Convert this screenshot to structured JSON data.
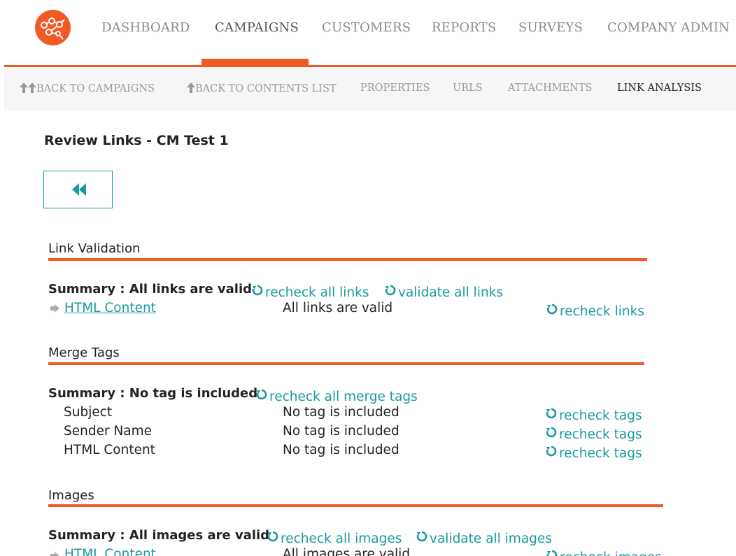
{
  "topnav": {
    "items": [
      {
        "label": "DASHBOARD"
      },
      {
        "label": "CAMPAIGNS",
        "active": true
      },
      {
        "label": "CUSTOMERS"
      },
      {
        "label": "REPORTS"
      },
      {
        "label": "SURVEYS"
      },
      {
        "label": "COMPANY ADMIN"
      }
    ]
  },
  "subnav": {
    "items": [
      {
        "label": "BACK TO CAMPAIGNS"
      },
      {
        "label": "BACK TO CONTENTS LIST"
      },
      {
        "label": "PROPERTIES"
      },
      {
        "label": "URLS"
      },
      {
        "label": "ATTACHMENTS"
      },
      {
        "label": "LINK ANALYSIS",
        "active": true
      }
    ]
  },
  "page": {
    "title": "Review Links - CM Test 1"
  },
  "colors": {
    "accent": "#f15a24",
    "link": "#1a9aa0"
  },
  "link_validation": {
    "title": "Link Validation",
    "summary": "Summary : All links are valid",
    "recheck_all": "recheck all links",
    "validate_all": "validate all links",
    "rows": [
      {
        "label": "HTML Content",
        "value": "All links are valid",
        "action": "recheck links"
      }
    ]
  },
  "merge_tags": {
    "title": "Merge Tags",
    "summary": "Summary : No tag is included",
    "recheck_all": "recheck all merge tags",
    "rows": [
      {
        "label": "Subject",
        "value": "No tag is included",
        "action": "recheck tags"
      },
      {
        "label": "Sender Name",
        "value": "No tag is included",
        "action": "recheck tags"
      },
      {
        "label": "HTML Content",
        "value": "No tag is included",
        "action": "recheck tags"
      }
    ]
  },
  "images": {
    "title": "Images",
    "summary": "Summary : All images are valid",
    "recheck_all": "recheck all images",
    "validate_all": "validate all images",
    "rows": [
      {
        "label": "HTML Content",
        "value": "All images are valid",
        "action": "recheck images"
      }
    ]
  }
}
